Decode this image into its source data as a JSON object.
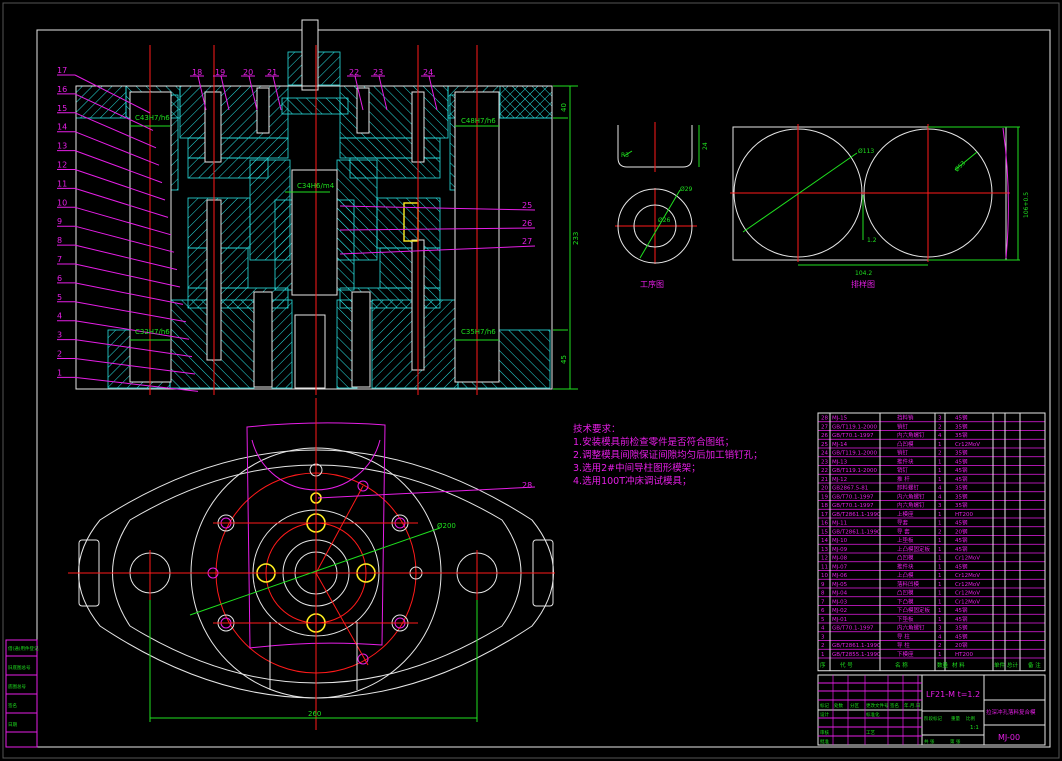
{
  "section_view": {
    "part_numbers_left": [
      "17",
      "16",
      "15",
      "14",
      "13",
      "12",
      "11",
      "10",
      "9",
      "8",
      "7",
      "6",
      "5",
      "4",
      "3",
      "2",
      "1"
    ],
    "part_numbers_top": [
      "18",
      "19",
      "20",
      "21",
      "22",
      "23",
      "24"
    ],
    "part_numbers_right": [
      "25",
      "26",
      "27"
    ],
    "fits": {
      "upper_left": "C43H7/h6",
      "upper_right": "C48H7/h6",
      "center": "C34H6/m4",
      "lower_left": "C32H7/h6",
      "lower_right": "C35H7/h6"
    },
    "dims": {
      "top_height": "40",
      "total_height": "233",
      "bottom_height": "45"
    }
  },
  "plan_view": {
    "part_number": "28",
    "pitch_diameter": "Ø200",
    "span": "260"
  },
  "workpiece_view": {
    "title": "工序图",
    "height": "24",
    "radius": "R3",
    "outer_dia": "Ø29",
    "inner_dia": "Ø26"
  },
  "layout_view": {
    "title": "排样图",
    "blank_dia": "Ø113",
    "blank_dia2": "Ø53",
    "pitch": "104.2",
    "gap": "1.2",
    "strip_width": "106+0.5"
  },
  "tech_requirements": {
    "title": "技术要求：",
    "items": [
      "1.安装模具前检查零件是否符合图纸；",
      "2.调整模具间隙保证间隙均匀后加工销钉孔；",
      "3.选用2#中间导柱图形模架；",
      "4.选用100T冲床调试模具；"
    ]
  },
  "parts_list": {
    "rows": [
      [
        "28",
        "MJ-15",
        "挡料销",
        "3",
        "45钢"
      ],
      [
        "27",
        "GB/T119.1-2000",
        "销钉",
        "2",
        "35钢"
      ],
      [
        "26",
        "GB/T70.1-1997",
        "内六角螺钉",
        "4",
        "35钢"
      ],
      [
        "25",
        "MJ-14",
        "凸凹模",
        "1",
        "Cr12MoV"
      ],
      [
        "24",
        "GB/T119.1-2000",
        "销钉",
        "2",
        "35钢"
      ],
      [
        "23",
        "MJ-13",
        "推件块",
        "1",
        "45钢"
      ],
      [
        "22",
        "GB/T119.1-2000",
        "销钉",
        "1",
        "45钢"
      ],
      [
        "21",
        "MJ-12",
        "推 杆",
        "1",
        "45钢"
      ],
      [
        "20",
        "GB2867.5-81",
        "卸料螺钉",
        "4",
        "35钢"
      ],
      [
        "19",
        "GB/T70.1-1997",
        "内六角螺钉",
        "4",
        "35钢"
      ],
      [
        "18",
        "GB/T70.1-1997",
        "内六角螺钉",
        "3",
        "35钢"
      ],
      [
        "17",
        "GB/T2861.1-1990",
        "上模座",
        "1",
        "HT200"
      ],
      [
        "16",
        "MJ-11",
        "导套",
        "1",
        "45钢"
      ],
      [
        "15",
        "GB/T2861.1-1990",
        "导 套",
        "2",
        "20钢"
      ],
      [
        "14",
        "MJ-10",
        "上垫板",
        "1",
        "45钢"
      ],
      [
        "13",
        "MJ-09",
        "上凸模固定板",
        "1",
        "45钢"
      ],
      [
        "12",
        "MJ-08",
        "凸凹模",
        "1",
        "Cr12MoV"
      ],
      [
        "11",
        "MJ-07",
        "推件块",
        "1",
        "45钢"
      ],
      [
        "10",
        "MJ-06",
        "上凸模",
        "1",
        "Cr12MoV"
      ],
      [
        "9",
        "MJ-05",
        "落料凹模",
        "1",
        "Cr12MoV"
      ],
      [
        "8",
        "MJ-04",
        "凸凹模",
        "1",
        "Cr12MoV"
      ],
      [
        "7",
        "MJ-03",
        "下凸模",
        "1",
        "Cr12MoV"
      ],
      [
        "6",
        "MJ-02",
        "下凸模固定板",
        "1",
        "45钢"
      ],
      [
        "5",
        "MJ-01",
        "下垫板",
        "1",
        "45钢"
      ],
      [
        "4",
        "GB/T70.1-1997",
        "内六角螺钉",
        "3",
        "35钢"
      ],
      [
        "3",
        "",
        "导 柱",
        "4",
        "45钢"
      ],
      [
        "2",
        "GB/T2861.1-1990",
        "导 柱",
        "2",
        "20钢"
      ],
      [
        "1",
        "GB/T2855.1-1990",
        "下模座",
        "1",
        "HT200"
      ]
    ],
    "header": [
      "序",
      "代 号",
      "名 称",
      "数量",
      "材 料",
      "单件",
      "总计",
      "备 注"
    ]
  },
  "title_block": {
    "material": "LF21-M t=1.2",
    "drawing_name": "拉深冲孔落料复合模",
    "drawing_number": "MJ-00",
    "labels": [
      "标记",
      "处数",
      "分区",
      "更改文件号",
      "签名",
      "年.月.日",
      "设计",
      "标准化",
      "阶段标记",
      "重量",
      "比例",
      "审核",
      "工艺",
      "批准",
      "共 张",
      "第 张"
    ],
    "scale": "1:1"
  },
  "side_strip": {
    "items": [
      "借(通)用件登记",
      "旧底图总号",
      "底图总号",
      "签名",
      "日期"
    ]
  }
}
